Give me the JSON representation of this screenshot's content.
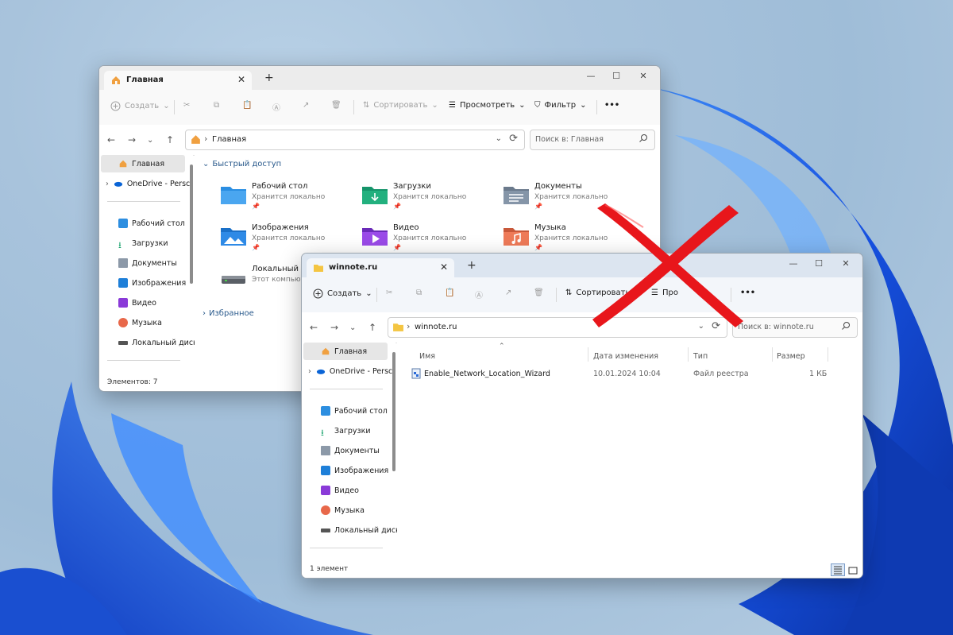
{
  "win1": {
    "tab_title": "Главная",
    "toolbar": {
      "create": "Создать",
      "sort": "Сортировать",
      "view": "Просмотреть",
      "filter": "Фильтр",
      "more": "•••"
    },
    "address": {
      "path": "Главная",
      "search_placeholder": "Поиск в: Главная"
    },
    "sidebar": {
      "home": "Главная",
      "onedrive": "OneDrive - Persc",
      "items": [
        "Рабочий стол",
        "Загрузки",
        "Документы",
        "Изображения",
        "Видео",
        "Музыка",
        "Локальный диск"
      ]
    },
    "quick_access": {
      "header": "Быстрый доступ",
      "items": [
        {
          "name": "Рабочий стол",
          "sub": "Хранится локально"
        },
        {
          "name": "Загрузки",
          "sub": "Хранится локально"
        },
        {
          "name": "Документы",
          "sub": "Хранится локально"
        },
        {
          "name": "Изображения",
          "sub": "Хранится локально"
        },
        {
          "name": "Видео",
          "sub": "Хранится локально"
        },
        {
          "name": "Музыка",
          "sub": "Хранится локально"
        },
        {
          "name": "Локальный ди",
          "sub": "Этот компьют"
        }
      ]
    },
    "favorites_header": "Избранное",
    "status": "Элементов: 7"
  },
  "win2": {
    "tab_title": "winnote.ru",
    "toolbar": {
      "create": "Создать",
      "sort": "Сортировать",
      "view": "Про",
      "more": "•••"
    },
    "address": {
      "path": "winnote.ru",
      "search_placeholder": "Поиск в: winnote.ru"
    },
    "sidebar": {
      "home": "Главная",
      "onedrive": "OneDrive - Persc",
      "items": [
        "Рабочий стол",
        "Загрузки",
        "Документы",
        "Изображения",
        "Видео",
        "Музыка",
        "Локальный диск"
      ]
    },
    "columns": {
      "name": "Имя",
      "date": "Дата изменения",
      "type": "Тип",
      "size": "Размер"
    },
    "file": {
      "name": "Enable_Network_Location_Wizard",
      "date": "10.01.2024 10:04",
      "type": "Файл реестра",
      "size": "1 КБ"
    },
    "status": "1 элемент"
  },
  "colors": {
    "cross": "#e8161b",
    "bloom": "#1450d8",
    "folder": "#f4c542",
    "accent": "#2a5a8c"
  }
}
